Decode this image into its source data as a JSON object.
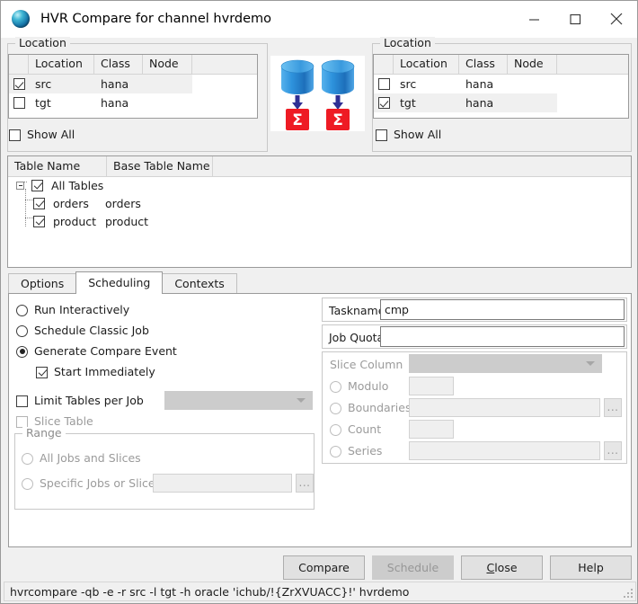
{
  "window": {
    "title": "HVR Compare for channel hvrdemo",
    "app_icon": "hvr-sphere-icon",
    "controls": {
      "minimize": "minimize-icon",
      "maximize": "maximize-icon",
      "close": "close-icon"
    }
  },
  "left_location": {
    "legend": "Location",
    "columns": [
      "",
      "Location",
      "Class",
      "Node",
      ""
    ],
    "rows": [
      {
        "checked": true,
        "location": "src",
        "class": "hana",
        "node": "",
        "selected": true
      },
      {
        "checked": false,
        "location": "tgt",
        "class": "hana",
        "node": "",
        "selected": false
      }
    ],
    "show_all": {
      "label": "Show All",
      "checked": false
    }
  },
  "right_location": {
    "legend": "Location",
    "columns": [
      "",
      "Location",
      "Class",
      "Node",
      ""
    ],
    "rows": [
      {
        "checked": false,
        "location": "src",
        "class": "hana",
        "node": "",
        "selected": false
      },
      {
        "checked": true,
        "location": "tgt",
        "class": "hana",
        "node": "",
        "selected": true
      }
    ],
    "show_all": {
      "label": "Show All",
      "checked": false
    }
  },
  "center_graphic": {
    "name": "compare-direction-graphic",
    "items": [
      "database-cylinder-icon",
      "down-arrow-icon",
      "sigma-compare-icon"
    ]
  },
  "tables": {
    "columns": [
      "Table Name",
      "Base Table Name"
    ],
    "root": {
      "label": "All Tables",
      "checked": true,
      "base": ""
    },
    "rows": [
      {
        "name": "orders",
        "base": "orders",
        "checked": true
      },
      {
        "name": "product",
        "base": "product",
        "checked": true
      }
    ]
  },
  "tabs": [
    {
      "label": "Options",
      "active": false
    },
    {
      "label": "Scheduling",
      "active": true
    },
    {
      "label": "Contexts",
      "active": false
    }
  ],
  "scheduling": {
    "mode": {
      "options": [
        {
          "label": "Run Interactively",
          "selected": false
        },
        {
          "label": "Schedule Classic Job",
          "selected": false
        },
        {
          "label": "Generate Compare Event",
          "selected": true
        }
      ],
      "start_immediately": {
        "label": "Start Immediately",
        "checked": true,
        "enabled": true
      }
    },
    "limit_tables_per_job": {
      "label": "Limit Tables per Job",
      "checked": false,
      "value": "",
      "enabled": true
    },
    "slice_table": {
      "label": "Slice Table",
      "checked": false,
      "enabled": false
    },
    "range": {
      "legend": "Range",
      "options": [
        {
          "label": "All Jobs and Slices",
          "selected": false
        },
        {
          "label": "Specific Jobs or Slices",
          "selected": false
        }
      ],
      "specific_value": "",
      "browse_label": "..."
    },
    "taskname": {
      "label": "Taskname",
      "value": "cmp"
    },
    "job_quota": {
      "label": "Job Quota",
      "value": ""
    },
    "slice": {
      "column_label": "Slice Column",
      "column_value": "",
      "options": [
        {
          "label": "Modulo",
          "selected": false,
          "value": "",
          "browse": false
        },
        {
          "label": "Boundaries",
          "selected": false,
          "value": "",
          "browse": true
        },
        {
          "label": "Count",
          "selected": false,
          "value": "",
          "browse": false
        },
        {
          "label": "Series",
          "selected": false,
          "value": "",
          "browse": true
        }
      ],
      "browse_label": "..."
    }
  },
  "buttons": {
    "compare": {
      "label": "Compare",
      "enabled": true
    },
    "schedule": {
      "label": "Schedule",
      "enabled": false
    },
    "close": {
      "label": "Close",
      "mnemonic": "C",
      "enabled": true
    },
    "help": {
      "label": "Help",
      "enabled": true
    }
  },
  "statusbar": {
    "command": "hvrcompare -qb -e -r src -l tgt -h oracle 'ichub/!{ZrXVUACC}!' hvrdemo"
  },
  "colors": {
    "dialog_bg": "#f0f0f0",
    "panel_white": "#ffffff",
    "db_blue": "#2f8fd8",
    "sigma_red": "#ee1b24",
    "arrow_navy": "#2a2a8c",
    "disabled_text": "#9b9b9b"
  }
}
